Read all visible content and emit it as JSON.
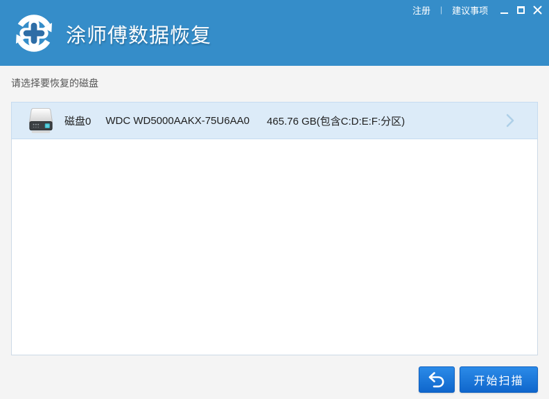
{
  "header": {
    "app_title": "涂师傅数据恢复",
    "links": {
      "register": "注册",
      "divider": "|",
      "suggestions": "建议事项"
    }
  },
  "main": {
    "prompt": "请选择要恢复的磁盘",
    "disks": [
      {
        "name": "磁盘0",
        "model": "WDC WD5000AAKX-75U6AA0",
        "capacity": "465.76 GB(包含C:D:E:F:分区)"
      }
    ]
  },
  "footer": {
    "scan_button": "开始扫描"
  },
  "colors": {
    "header_blue": "#358dc9",
    "button_blue": "#1472d8",
    "row_highlight": "#dcebf8",
    "row_border": "#c5dbf0",
    "panel_border": "#ccd9e6",
    "page_bg": "#f4f4f4",
    "disk_led_teal": "#38b8c8"
  }
}
